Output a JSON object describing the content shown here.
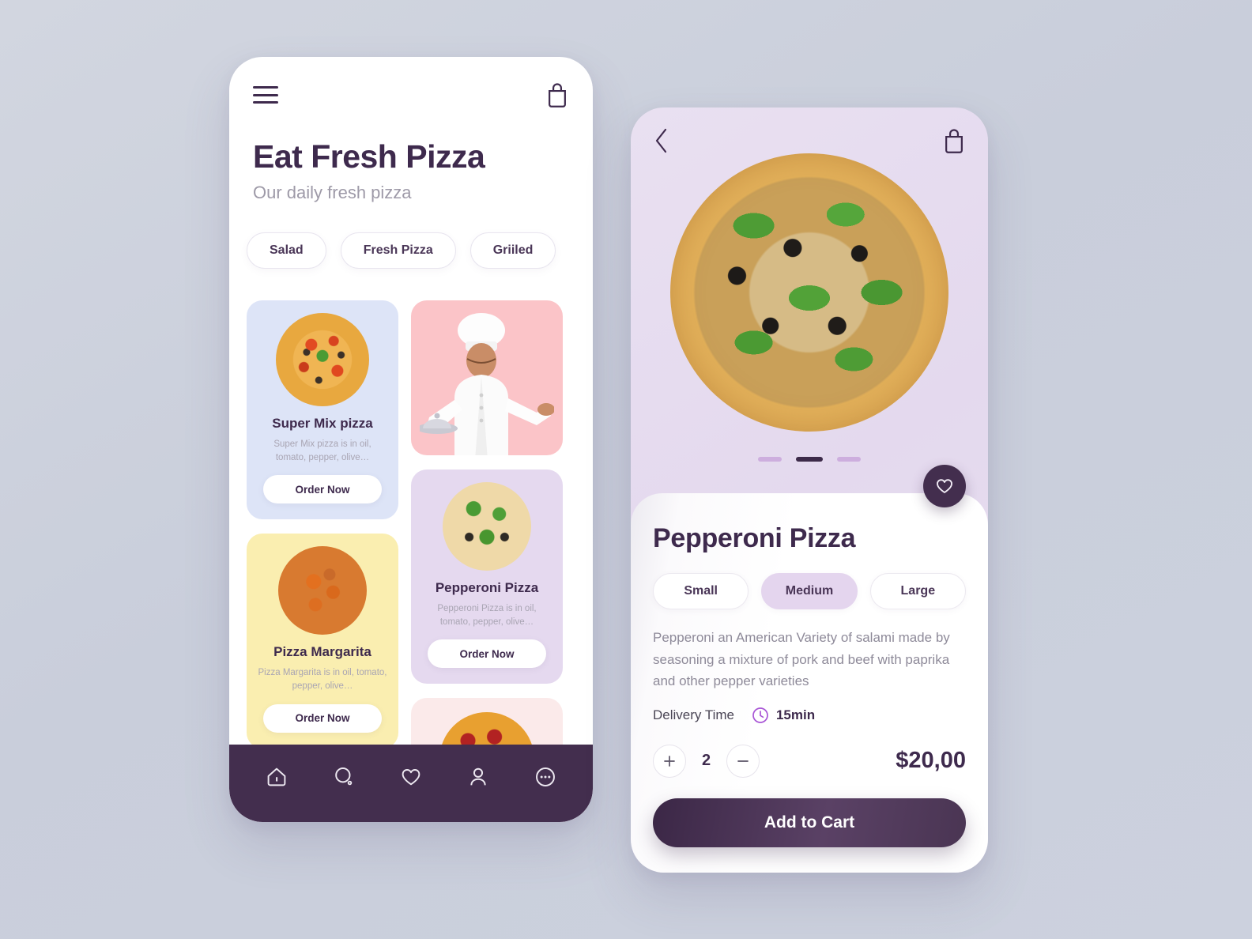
{
  "theme": {
    "page_bg": "#ccd0dc",
    "dark_purple": "#432e4e",
    "title_purple": "#3e2a4d",
    "muted": "#9e9aa8",
    "card_blue": "#dde4f7",
    "card_pink": "#fbc4c8",
    "card_yellow": "#faeeb0",
    "card_lilac": "#e5d9ef",
    "card_pink_light": "#fbeaea",
    "detail_bg": "#e4d9ee",
    "accent_purple": "#a855d6"
  },
  "list_screen": {
    "topbar": {
      "menu_icon": "hamburger-icon",
      "bag_icon": "shopping-bag-icon"
    },
    "title": "Eat Fresh Pizza",
    "subtitle": "Our daily fresh pizza",
    "categories": [
      {
        "label": "Salad"
      },
      {
        "label": "Fresh Pizza"
      },
      {
        "label": "Griiled"
      }
    ],
    "cards": [
      {
        "title": "Super Mix pizza",
        "description": "Super Mix pizza is in oil, tomato, pepper, olive…",
        "button": "Order Now",
        "bg": "#dde4f7"
      },
      {
        "title": "Pizza Margarita",
        "description": "Pizza Margarita is in oil, tomato, pepper, olive…",
        "button": "Order Now",
        "bg": "#faeeb0"
      },
      {
        "title": "Pepperoni Pizza",
        "description": "Pepperoni Pizza is in oil, tomato, pepper, olive…",
        "button": "Order Now",
        "bg": "#e5d9ef"
      }
    ],
    "chef_card": {
      "bg": "#fbc4c8",
      "image": "chef-with-tray-photo"
    },
    "peek_card": {
      "bg": "#fbeaea",
      "image": "pepperoni-pizza-photo"
    },
    "bottom_nav": [
      {
        "icon": "home-icon",
        "active": true
      },
      {
        "icon": "search-icon",
        "active": false
      },
      {
        "icon": "heart-icon",
        "active": false
      },
      {
        "icon": "profile-icon",
        "active": false
      },
      {
        "icon": "more-dots-icon",
        "active": false
      }
    ]
  },
  "detail_screen": {
    "topbar": {
      "back_icon": "chevron-left-icon",
      "bag_icon": "shopping-bag-icon"
    },
    "hero_image": "pepperoni-pizza-with-basil-photo",
    "carousel": {
      "total": 3,
      "active_index": 1
    },
    "favorite_icon": "heart-icon",
    "title": "Pepperoni Pizza",
    "sizes": [
      {
        "label": "Small",
        "selected": false
      },
      {
        "label": "Medium",
        "selected": true
      },
      {
        "label": "Large",
        "selected": false
      }
    ],
    "description": "Pepperoni an American Variety of salami made by seasoning a mixture of pork and beef with paprika and other pepper varieties",
    "delivery": {
      "label": "Delivery Time",
      "icon": "clock-icon",
      "value": "15min"
    },
    "quantity": {
      "increase_icon": "plus-icon",
      "value": "2",
      "decrease_icon": "minus-icon"
    },
    "price": "$20,00",
    "cart_button": "Add to Cart"
  }
}
